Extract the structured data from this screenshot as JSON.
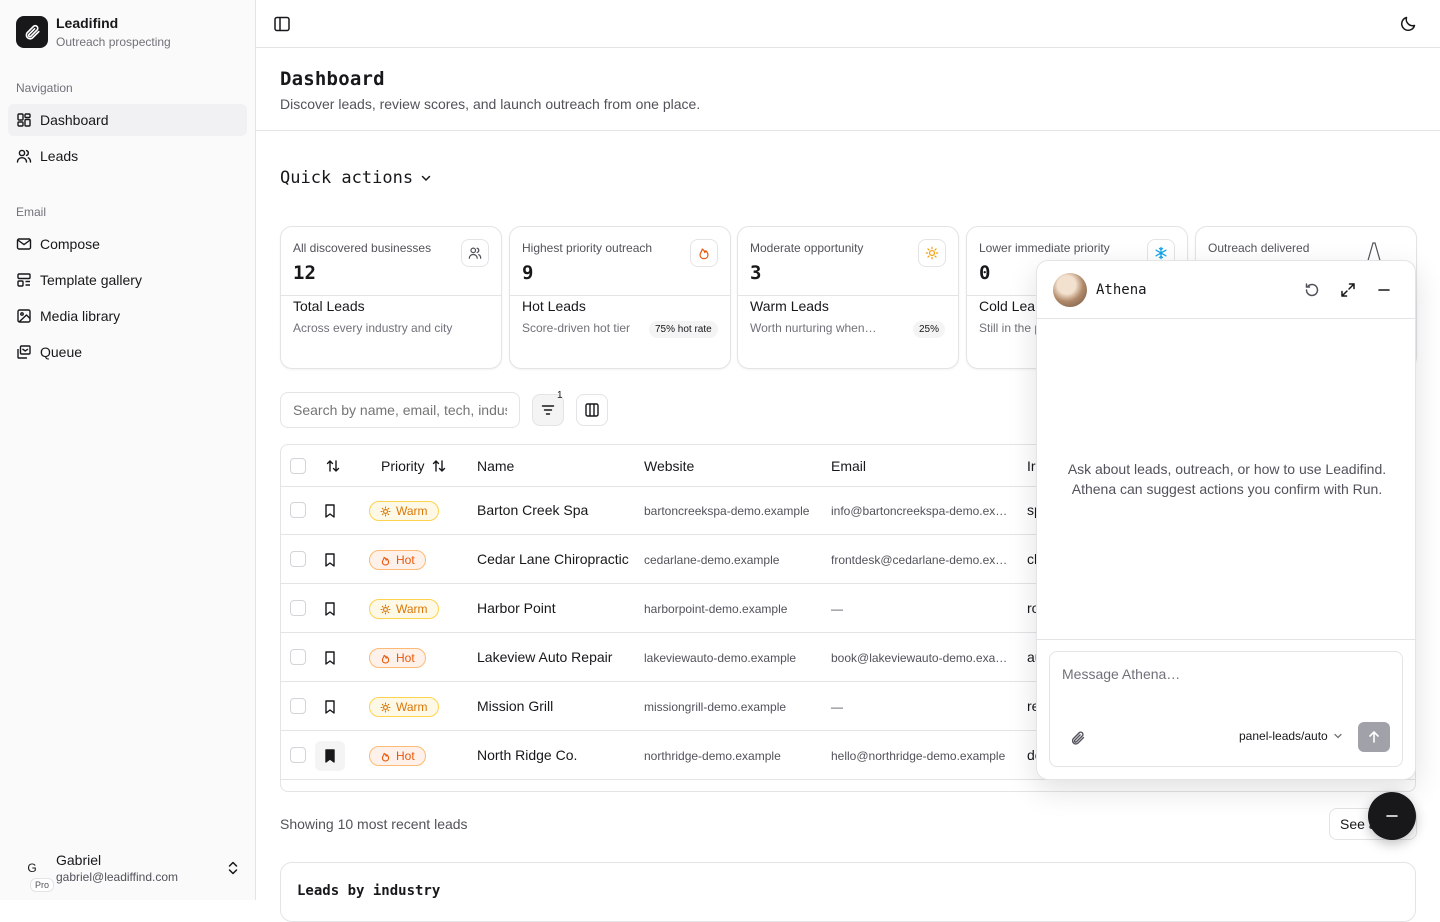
{
  "app": {
    "name": "Leadifind",
    "subtitle": "Outreach prospecting"
  },
  "sidebar": {
    "groups": [
      {
        "label": "Navigation",
        "items": [
          {
            "label": "Dashboard",
            "icon": "dashboard-icon",
            "active": true
          },
          {
            "label": "Leads",
            "icon": "users-icon"
          }
        ]
      },
      {
        "label": "Email",
        "items": [
          {
            "label": "Compose",
            "icon": "mail-icon"
          },
          {
            "label": "Template gallery",
            "icon": "template-icon"
          },
          {
            "label": "Media library",
            "icon": "image-icon"
          },
          {
            "label": "Queue",
            "icon": "queue-icon"
          }
        ]
      }
    ],
    "user": {
      "initial": "G",
      "plan": "Pro",
      "name": "Gabriel",
      "email": "gabriel@leadiffind.com"
    }
  },
  "page": {
    "title": "Dashboard",
    "description": "Discover leads, review scores, and launch outreach from one place.",
    "quick_actions_label": "Quick actions"
  },
  "cards": [
    {
      "sub": "All discovered businesses",
      "value": "12",
      "title": "Total Leads",
      "desc": "Across every industry and city",
      "badge": "",
      "icon": "users-icon",
      "icon_color": "#52525b"
    },
    {
      "sub": "Highest priority outreach",
      "value": "9",
      "title": "Hot Leads",
      "desc": "Score-driven hot tier",
      "badge": "75% hot rate",
      "icon": "flame-icon",
      "icon_color": "#ea580c"
    },
    {
      "sub": "Moderate opportunity",
      "value": "3",
      "title": "Warm Leads",
      "desc": "Worth nurturing when…",
      "badge": "25%",
      "icon": "sun-icon",
      "icon_color": "#f59e0b"
    },
    {
      "sub": "Lower immediate priority",
      "value": "0",
      "title": "Cold Lea",
      "desc": "Still in the p",
      "badge": "",
      "icon": "snowflake-icon",
      "icon_color": "#0ea5e9"
    },
    {
      "sub": "Outreach delivered",
      "value": "",
      "title": "",
      "desc": "",
      "badge": "",
      "icon": "sparkline-icon",
      "icon_color": "#52525b"
    }
  ],
  "toolbar": {
    "search_placeholder": "Search by name, email, tech, industry",
    "filter_count": "1"
  },
  "table": {
    "columns": [
      "Priority",
      "Name",
      "Website",
      "Email",
      "Ir"
    ],
    "rows": [
      {
        "priority": "Warm",
        "name": "Barton Creek Spa",
        "website": "bartoncreekspa-demo.example",
        "email": "info@bartoncreekspa-demo.example",
        "industry": "sp",
        "saved": false
      },
      {
        "priority": "Hot",
        "name": "Cedar Lane Chiropractic",
        "website": "cedarlane-demo.example",
        "email": "frontdesk@cedarlane-demo.example",
        "industry": "cl",
        "saved": false
      },
      {
        "priority": "Warm",
        "name": "Harbor Point",
        "website": "harborpoint-demo.example",
        "email": "—",
        "industry": "ro",
        "saved": false
      },
      {
        "priority": "Hot",
        "name": "Lakeview Auto Repair",
        "website": "lakeviewauto-demo.example",
        "email": "book@lakeviewauto-demo.example",
        "industry": "au",
        "saved": false
      },
      {
        "priority": "Warm",
        "name": "Mission Grill",
        "website": "missiongrill-demo.example",
        "email": "—",
        "industry": "re",
        "saved": false
      },
      {
        "priority": "Hot",
        "name": "North Ridge Co.",
        "website": "northridge-demo.example",
        "email": "hello@northridge-demo.example",
        "industry": "de",
        "saved": true
      }
    ]
  },
  "footer": {
    "showing": "Showing 10 most recent leads",
    "see_all": "See all"
  },
  "industry_section": {
    "title": "Leads by industry"
  },
  "chat": {
    "name": "Athena",
    "empty_line1": "Ask about leads, outreach, or how to use Leadifind.",
    "empty_line2": "Athena can suggest actions you confirm with Run.",
    "placeholder": "Message Athena…",
    "model": "panel-leads/auto"
  },
  "colors": {
    "warm": "#d97706",
    "hot": "#ea580c",
    "accent": "#18181b"
  }
}
